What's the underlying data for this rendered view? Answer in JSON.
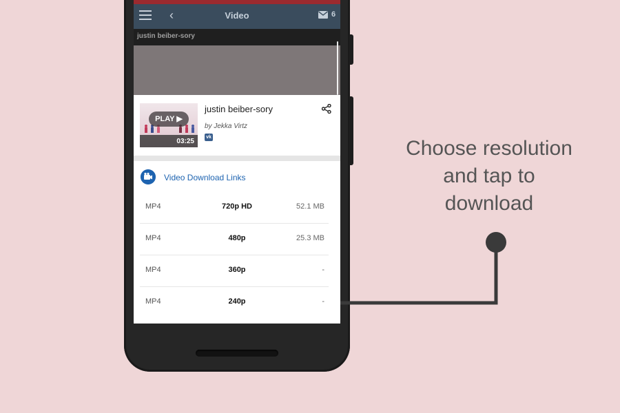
{
  "app_bar": {
    "title": "Video",
    "message_count": "6"
  },
  "video_player": {
    "title": "justin beiber-sory"
  },
  "video_card": {
    "thumbnail_play_label": "PLAY ▶",
    "duration": "03:25",
    "name": "justin beiber-sory",
    "author": "by Jekka Virtz",
    "source_badge": "vk"
  },
  "downloads": {
    "header": "Video Download Links",
    "rows": [
      {
        "format": "MP4",
        "resolution": "720p HD",
        "size": "52.1 MB"
      },
      {
        "format": "MP4",
        "resolution": "480p",
        "size": "25.3 MB"
      },
      {
        "format": "MP4",
        "resolution": "360p",
        "size": "-"
      },
      {
        "format": "MP4",
        "resolution": "240p",
        "size": "-"
      }
    ]
  },
  "annotation": {
    "line1": "Choose resolution",
    "line2": "and tap to",
    "line3": "download"
  },
  "colors": {
    "background": "#efd6d7",
    "app_bar": "#3a4c5d",
    "accent_blue": "#1d63b0",
    "status_strip": "#9b2a2f",
    "connector": "#3a3a3a"
  }
}
